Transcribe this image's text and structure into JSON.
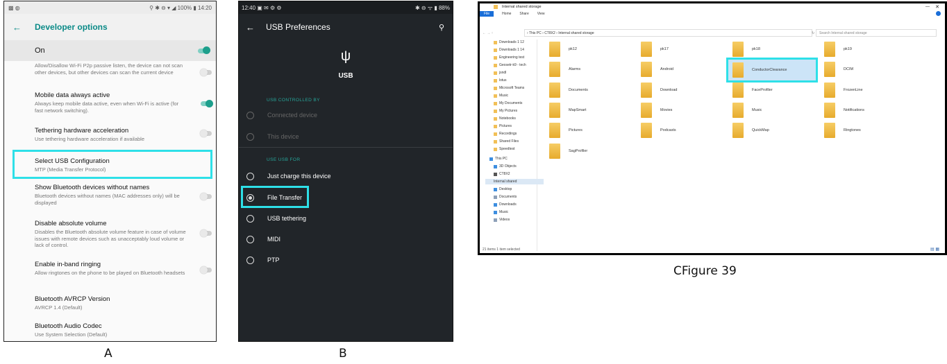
{
  "panel_a": {
    "status_bar": {
      "right": "⚲ ✱ ⊖ ▾ ◢ 100% ▮ 14:20"
    },
    "app_bar_title": "Developer options",
    "on_label": "On",
    "items": [
      {
        "title": "",
        "desc": "Allow/Disallow Wi-Fi P2p passive listen, the device can not scan other devices, but other devices can scan the current device",
        "toggle": "off"
      },
      {
        "title": "Mobile data always active",
        "desc": "Always keep mobile data active, even when Wi-Fi is active (for fast network switching).",
        "toggle": "on"
      },
      {
        "title": "Tethering hardware acceleration",
        "desc": "Use tethering hardware acceleration if available",
        "toggle": "off"
      },
      {
        "title": "Select USB Configuration",
        "desc": "MTP (Media Transfer Protocol)",
        "toggle": "none"
      },
      {
        "title": "Show Bluetooth devices without names",
        "desc": "Bluetooth devices without names (MAC addresses only) will be displayed",
        "toggle": "off"
      },
      {
        "title": "Disable absolute volume",
        "desc": "Disables the Bluetooth absolute volume feature in case of volume issues with remote devices such as unacceptably loud volume or lack of control.",
        "toggle": "off"
      },
      {
        "title": "Enable in-band ringing",
        "desc": "Allow ringtones on the phone to be played on Bluetooth headsets",
        "toggle": "off"
      },
      {
        "title": "Bluetooth AVRCP Version",
        "desc": "AVRCP 1.4 (Default)",
        "toggle": "none"
      },
      {
        "title": "Bluetooth Audio Codec",
        "desc": "Use System Selection (Default)",
        "toggle": "none"
      }
    ],
    "caption": "A"
  },
  "panel_b": {
    "status_bar": {
      "left": "12:40 ▣ ✉ ⚙ ⚙",
      "right": "✱ ⊖ ᯤ ▮ 88%"
    },
    "app_bar_title": "USB Preferences",
    "usb_label": "USB",
    "section_controlled": "USB CONTROLLED BY",
    "controlled_options": [
      "Connected device",
      "This device"
    ],
    "section_use": "USE USB FOR",
    "use_options": [
      "Just charge this device",
      "File Transfer",
      "USB tethering",
      "MIDI",
      "PTP"
    ],
    "selected_use_index": 1,
    "caption": "B"
  },
  "panel_c": {
    "title": "Internal shared storage",
    "ribbon": [
      "File",
      "Home",
      "Share",
      "View"
    ],
    "address": "› This PC › CT8X2 › Internal shared storage",
    "search_placeholder": "Search Internal shared storage",
    "nav_items": [
      "Downloads 1 12",
      "Downloads 1 14",
      "Engineering test",
      "Geosetr-k9 - tech",
      "jsndl",
      "lotus",
      "Microsoft Teams",
      "Music",
      "My Documents",
      "My Pictures",
      "Notebooks",
      "Pictures",
      "Recordings",
      "Shared Files",
      "Speedtest",
      "This PC",
      "3D Objects",
      "CT8X2",
      "Internal shared",
      "Desktop",
      "Documents",
      "Downloads",
      "Music",
      "Videos"
    ],
    "folders": [
      "pk12",
      "pk17",
      "pk18",
      "pk19",
      "Alarms",
      "Android",
      "ConductorClearance",
      "DCIM",
      "Documents",
      "Download",
      "FaceProfiler",
      "FrozenLine",
      "MapSmart",
      "Movies",
      "Music",
      "Notifications",
      "Pictures",
      "Podcasts",
      "QuickMap",
      "Ringtones",
      "SagProfiler"
    ],
    "selected_folder": "ConductorClearance",
    "status": "21 items   1 item selected",
    "caption": "CFigure 39"
  }
}
